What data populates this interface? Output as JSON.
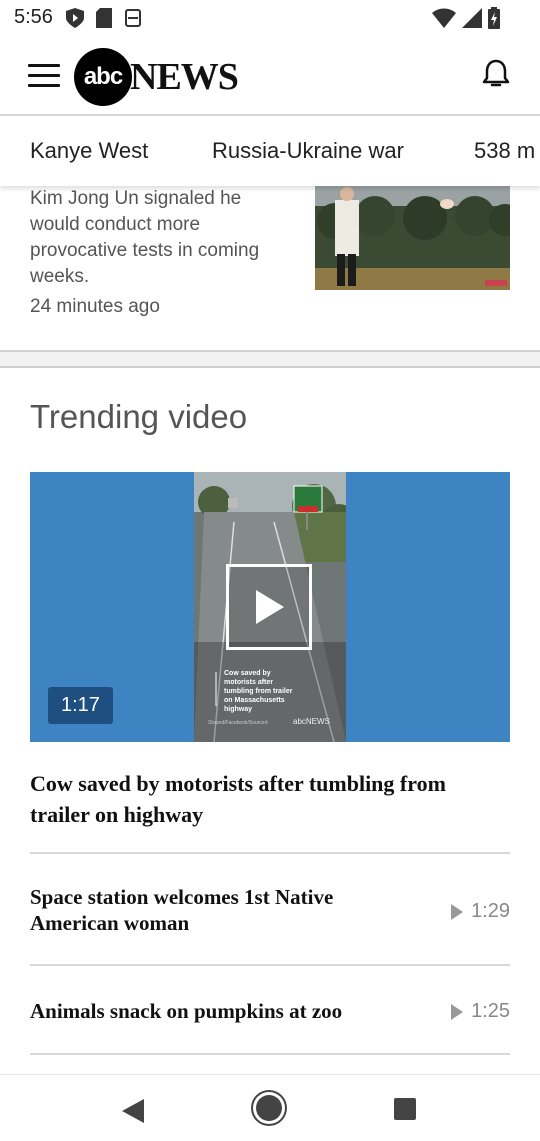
{
  "status_bar": {
    "time": "5:56"
  },
  "app_bar": {
    "logo_abc": "abc",
    "logo_news": "NEWS"
  },
  "topics": [
    "Kanye West",
    "Russia-Ukraine war",
    "538 m"
  ],
  "top_article": {
    "summary": "Kim Jong Un signaled he would conduct more provocative tests in coming weeks.",
    "timestamp": "24 minutes ago"
  },
  "trending": {
    "section_title": "Trending video",
    "featured": {
      "duration": "1:17",
      "headline": "Cow saved by motorists after tumbling from trailer on highway",
      "frame_caption": "Cow saved by motorists after tumbling from trailer on Massachusetts highway",
      "frame_watermark": "abcNEWS",
      "frame_credit": "Shared/Facebook/Sourced"
    },
    "items": [
      {
        "title": "Space station welcomes 1st Native American woman",
        "duration": "1:29"
      },
      {
        "title": "Animals snack on pumpkins at zoo",
        "duration": "1:25"
      }
    ]
  },
  "colors": {
    "video_bg": "#3f84c2",
    "duration_badge": "#1e4f80"
  },
  "icons": [
    "hamburger-menu-icon",
    "bell-icon",
    "play-icon",
    "back-icon",
    "home-icon",
    "recents-icon"
  ]
}
